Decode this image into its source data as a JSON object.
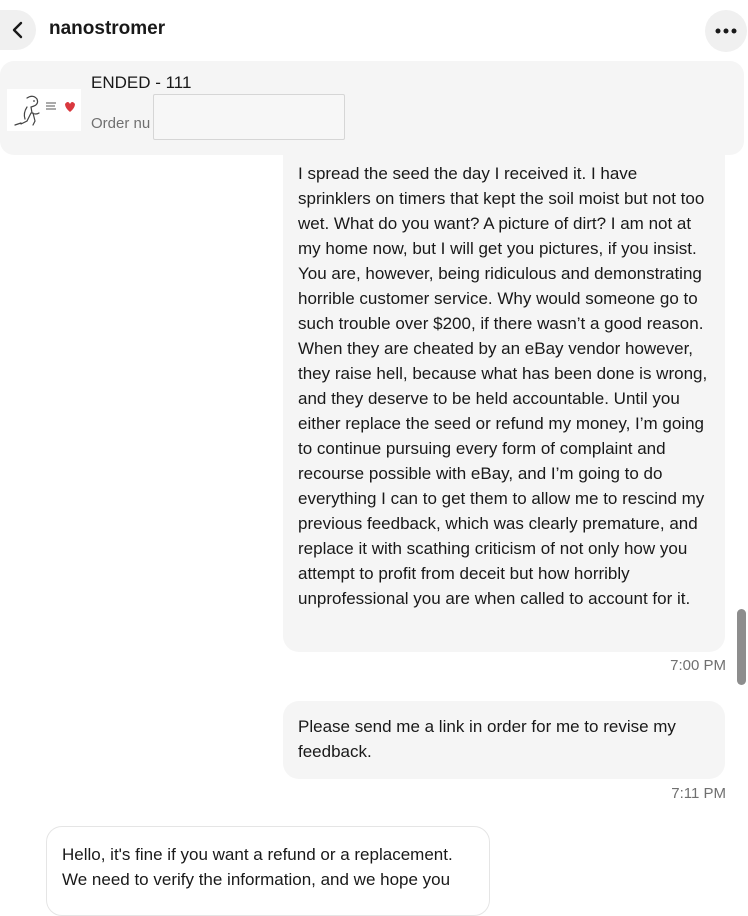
{
  "header": {
    "title": "nanostromer"
  },
  "item": {
    "title": "ENDED - 111",
    "order_label": "Order nu"
  },
  "messages": [
    {
      "text": "I spread the seed the day I received it. I have sprinklers on timers that kept the soil moist but not too wet. What do you want? A picture of dirt? I am not at my home now, but I will get you pictures, if you insist. You are, however, being ridiculous and demonstrating horrible customer service. Why would someone go to such trouble over $200, if there wasn’t a good reason. When they are cheated by an eBay vendor however, they raise hell, because what has been done is wrong, and they deserve to be held accountable. Until you either replace the seed or refund my money, I’m going to continue pursuing every form of complaint and recourse possible with eBay, and I’m going to do everything I can to get them to allow me to rescind my previous feedback, which was clearly premature, and replace it with scathing criticism of not only how you attempt to profit from deceit but how horribly unprofessional you are when called to account for it.",
      "time": "7:00 PM"
    },
    {
      "text": "Please send me a link in order for me to revise my feedback.",
      "time": "7:11 PM"
    },
    {
      "text": "Hello, it's fine if you want a refund or a replacement. We need to verify the information, and we hope you",
      "time": ""
    }
  ],
  "icons": {
    "back": "chevron-left-icon",
    "more": "more-horizontal-icon",
    "thumbnail": "dino-heart-thumbnail"
  },
  "colors": {
    "bubble_out": "#f5f5f5",
    "card": "#f5f5f5",
    "text": "#191919",
    "muted": "#707070"
  }
}
